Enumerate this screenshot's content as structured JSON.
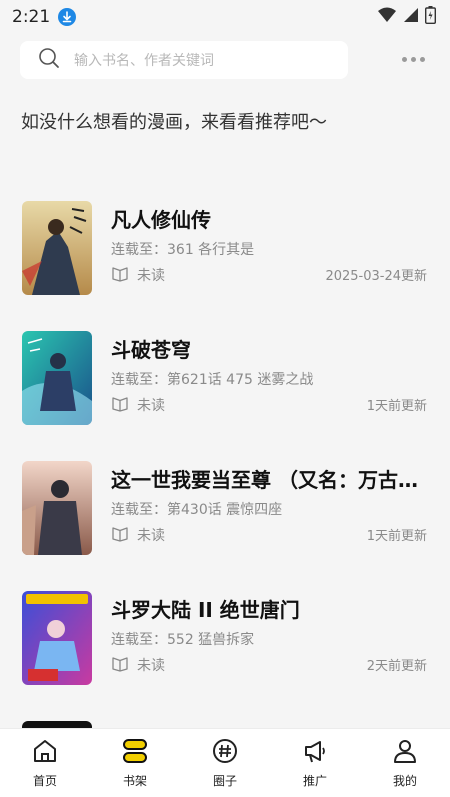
{
  "status": {
    "time": "2:21"
  },
  "search": {
    "placeholder": "输入书名、作者关键词"
  },
  "recommend_text": "如没什么想看的漫画，来看看推荐吧～",
  "books": [
    {
      "title": "凡人修仙传",
      "chapter": "连载至：361 各行其是",
      "read": "未读",
      "updated": "2025-03-24更新"
    },
    {
      "title": "斗破苍穹",
      "chapter": "连载至：第621话 475 迷雾之战",
      "read": "未读",
      "updated": "1天前更新"
    },
    {
      "title": "这一世我要当至尊 （又名：万古…",
      "chapter": "连载至：第430话 震惊四座",
      "read": "未读",
      "updated": "1天前更新"
    },
    {
      "title": "斗罗大陆 II 绝世唐门",
      "chapter": "连载至：552 猛兽拆家",
      "read": "未读",
      "updated": "2天前更新"
    }
  ],
  "tabs": [
    {
      "label": "首页",
      "icon": "home-icon"
    },
    {
      "label": "书架",
      "icon": "bookshelf-icon"
    },
    {
      "label": "圈子",
      "icon": "hashtag-icon"
    },
    {
      "label": "推广",
      "icon": "megaphone-icon"
    },
    {
      "label": "我的",
      "icon": "profile-icon"
    }
  ],
  "colors": {
    "accent": "#f2cf00",
    "download": "#1e88e5",
    "background": "#f5f5f5"
  }
}
